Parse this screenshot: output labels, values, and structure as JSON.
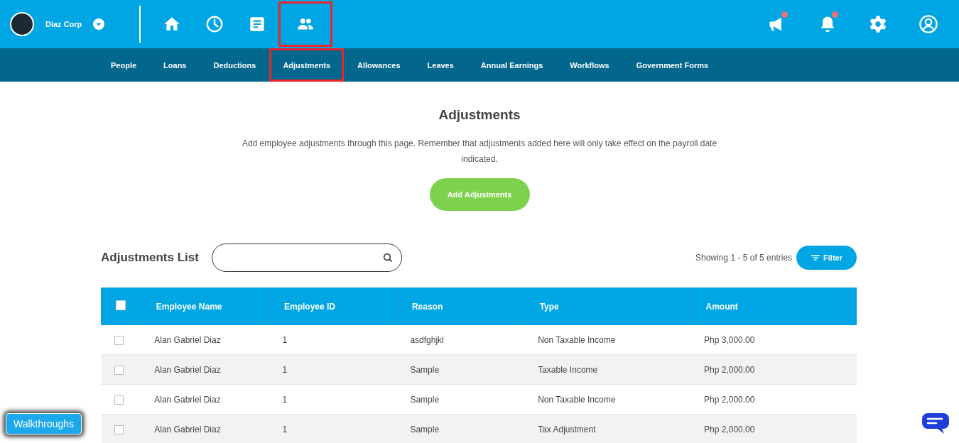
{
  "company": {
    "name": "Diaz Corp"
  },
  "nav_icons": [
    {
      "kind": "home",
      "highlighted": false
    },
    {
      "kind": "clock",
      "highlighted": false
    },
    {
      "kind": "document",
      "highlighted": false
    },
    {
      "kind": "people",
      "highlighted": true
    }
  ],
  "header_actions": [
    {
      "kind": "megaphone",
      "badge": true
    },
    {
      "kind": "bell",
      "badge": true
    },
    {
      "kind": "settings",
      "badge": false
    },
    {
      "kind": "user",
      "badge": false
    }
  ],
  "tabs": [
    {
      "label": "People",
      "highlighted": false
    },
    {
      "label": "Loans",
      "highlighted": false
    },
    {
      "label": "Deductions",
      "highlighted": false
    },
    {
      "label": "Adjustments",
      "highlighted": true
    },
    {
      "label": "Allowances",
      "highlighted": false
    },
    {
      "label": "Leaves",
      "highlighted": false
    },
    {
      "label": "Annual Earnings",
      "highlighted": false
    },
    {
      "label": "Workflows",
      "highlighted": false
    },
    {
      "label": "Government Forms",
      "highlighted": false
    }
  ],
  "page": {
    "title": "Adjustments",
    "description": "Add employee adjustments through this page. Remember that adjustments added here will only take effect on the payroll date indicated.",
    "add_button": "Add Adjustments"
  },
  "list": {
    "title": "Adjustments List",
    "entries_info": "Showing 1 - 5 of 5 entries",
    "filter_button": "Filter"
  },
  "table": {
    "select_all_checked": false,
    "columns": [
      "Employee Name",
      "Employee ID",
      "Reason",
      "Type",
      "Amount"
    ],
    "rows": [
      {
        "checked": false,
        "cells": [
          "Alan Gabriel Diaz",
          "1",
          "asdfghjkl",
          "Non Taxable Income",
          "Php 3,000.00"
        ]
      },
      {
        "checked": false,
        "cells": [
          "Alan Gabriel Diaz",
          "1",
          "Sample",
          "Taxable Income",
          "Php 2,000.00"
        ]
      },
      {
        "checked": false,
        "cells": [
          "Alan Gabriel Diaz",
          "1",
          "Sample",
          "Non Taxable Income",
          "Php 2,000.00"
        ]
      },
      {
        "checked": false,
        "cells": [
          "Alan Gabriel Diaz",
          "1",
          "Sample",
          "Tax Adjustment",
          "Php 2,000.00"
        ]
      }
    ]
  },
  "walkthroughs_button": "Walkthroughs"
}
